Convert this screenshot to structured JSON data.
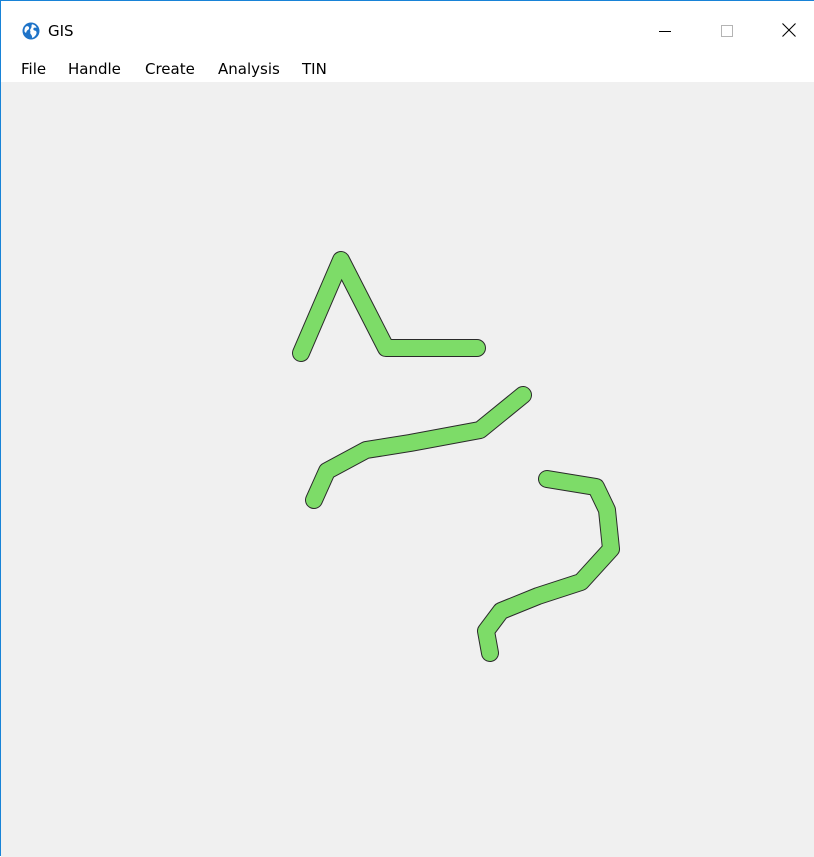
{
  "window": {
    "title": "GIS",
    "icon": "globe-icon",
    "controls": {
      "minimize_icon": "minimize-icon",
      "maximize_icon": "maximize-icon",
      "close_icon": "close-icon"
    }
  },
  "menu": {
    "items": [
      {
        "label": "File"
      },
      {
        "label": "Handle"
      },
      {
        "label": "Create"
      },
      {
        "label": "Analysis"
      },
      {
        "label": "TIN"
      }
    ]
  },
  "map": {
    "background_color": "#f0f0f0",
    "line_fill_color": "#7ddc68",
    "line_outline_color": "#2a2a2a",
    "feature_count": 3
  }
}
